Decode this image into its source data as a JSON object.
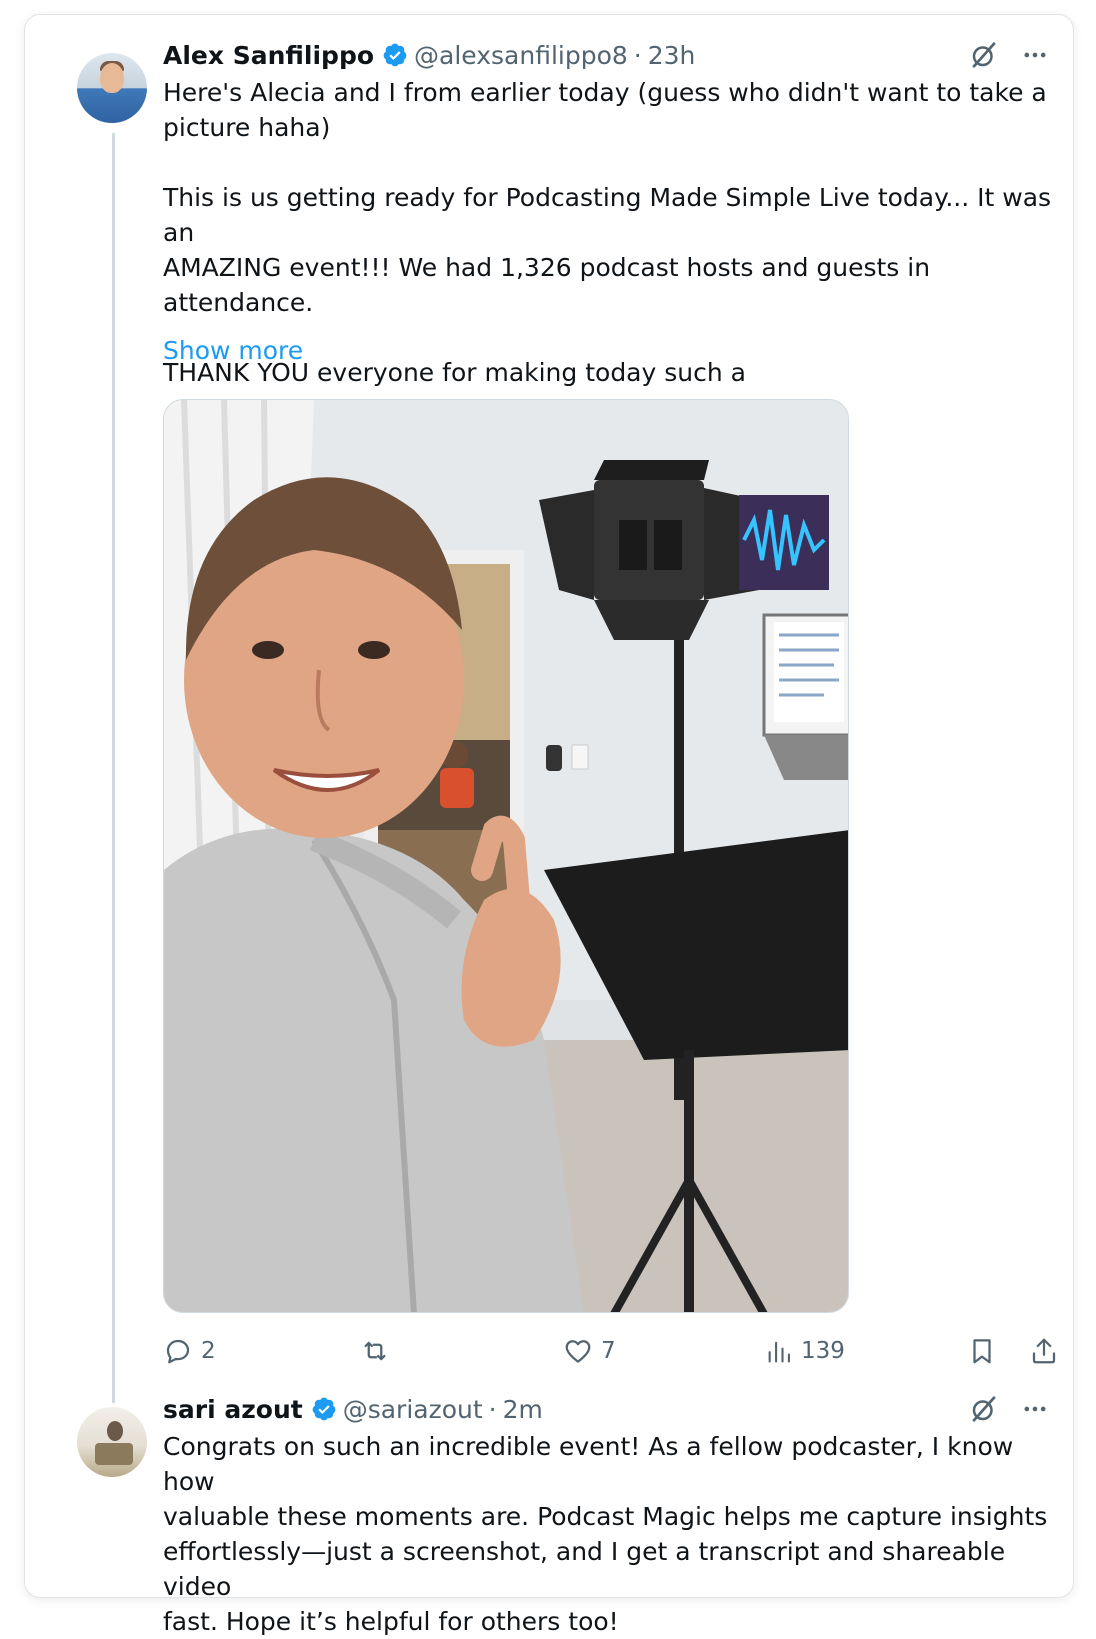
{
  "tweet": {
    "author_name": "Alex Sanfilippo",
    "handle": "@alexsanfilippo8",
    "separator": "·",
    "time": "23h",
    "text": "Here's Alecia and I from earlier today (guess who didn't want to take a\npicture haha)\n\nThis is us getting ready for Podcasting Made Simple Live today... It was an\nAMAZING event!!! We had 1,326 podcast hosts and guests in attendance.\n\nTHANK YOU everyone for making today such a",
    "show_more": "Show more",
    "stats": {
      "replies": "2",
      "retweets": "",
      "likes": "7",
      "views": "139"
    }
  },
  "reply": {
    "author_name": "sari azout",
    "handle": "@sariazout",
    "separator": "·",
    "time": "2m",
    "text": "Congrats on such an incredible event! As a fellow podcaster, I know how\nvaluable these moments are. Podcast Magic helps me capture insights\neffortlessly—just a screenshot, and I get a transcript and shareable video\nfast. Hope it’s helpful for others too!"
  },
  "icons": {
    "verified": "verified-badge-icon",
    "grok": "grok-icon",
    "more": "more-icon",
    "reply": "reply-icon",
    "retweet": "retweet-icon",
    "like": "like-icon",
    "views": "views-icon",
    "bookmark": "bookmark-icon",
    "share": "share-icon"
  },
  "colors": {
    "accent": "#1d9bf0",
    "secondary_text": "#536471",
    "thread_line": "#cfd9de"
  }
}
